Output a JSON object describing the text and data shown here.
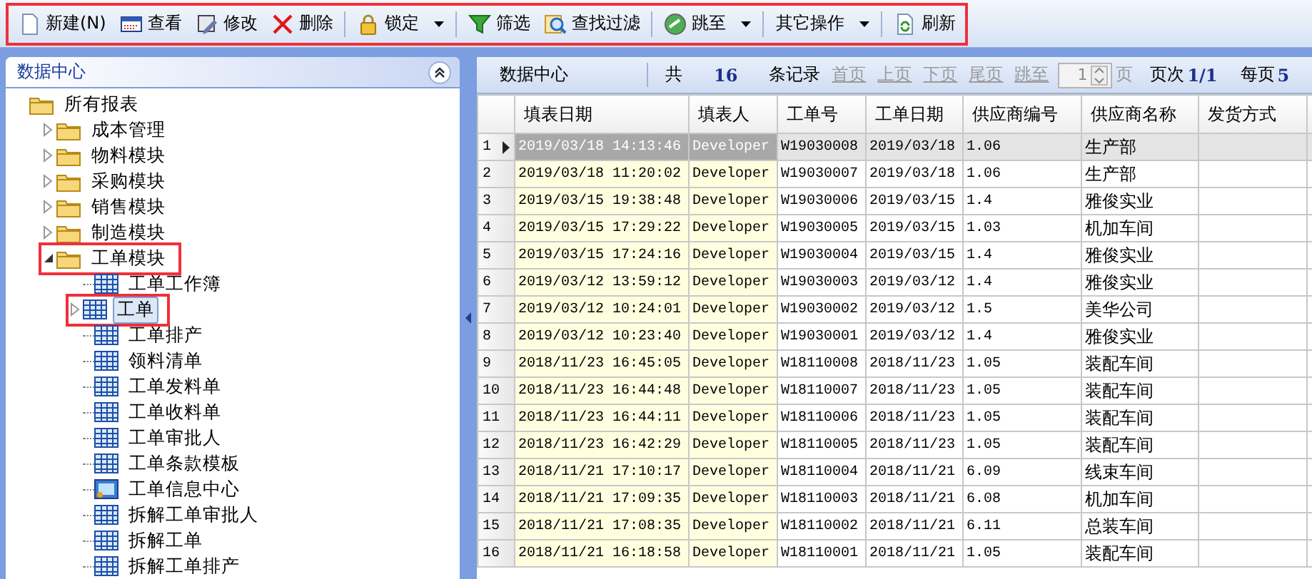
{
  "toolbar": {
    "highlighted": true,
    "items": [
      {
        "kind": "button",
        "label": "新建(N)"
      },
      {
        "kind": "button",
        "label": "查看"
      },
      {
        "kind": "button",
        "label": "修改"
      },
      {
        "kind": "button",
        "label": "删除"
      },
      {
        "kind": "separator"
      },
      {
        "kind": "dropdown",
        "label": "锁定"
      },
      {
        "kind": "separator"
      },
      {
        "kind": "button",
        "label": "筛选"
      },
      {
        "kind": "button",
        "label": "查找过滤"
      },
      {
        "kind": "separator"
      },
      {
        "kind": "dropdown",
        "label": "跳至"
      },
      {
        "kind": "separator"
      },
      {
        "kind": "dropdown",
        "label": "其它操作"
      },
      {
        "kind": "separator"
      },
      {
        "kind": "button",
        "label": "刷新"
      }
    ]
  },
  "sidebar": {
    "title": "数据中心",
    "tree": [
      {
        "label": "所有报表",
        "kind": "folder",
        "children": [
          {
            "label": "成本管理",
            "kind": "folder",
            "expanded": false
          },
          {
            "label": "物料模块",
            "kind": "folder",
            "expanded": false
          },
          {
            "label": "采购模块",
            "kind": "folder",
            "expanded": false
          },
          {
            "label": "销售模块",
            "kind": "folder",
            "expanded": false
          },
          {
            "label": "制造模块",
            "kind": "folder",
            "expanded": false
          },
          {
            "label": "工单模块",
            "kind": "folder",
            "expanded": true,
            "highlighted": true,
            "children": [
              {
                "label": "工单工作簿",
                "kind": "table",
                "selected": false
              },
              {
                "label": "工单",
                "kind": "table",
                "selected": true,
                "expanded": false,
                "highlighted": true
              },
              {
                "label": "工单排产",
                "kind": "table",
                "selected": false
              },
              {
                "label": "领料清单",
                "kind": "table",
                "selected": false
              },
              {
                "label": "工单发料单",
                "kind": "table",
                "selected": false
              },
              {
                "label": "工单收料单",
                "kind": "table",
                "selected": false
              },
              {
                "label": "工单审批人",
                "kind": "table",
                "selected": false
              },
              {
                "label": "工单条款模板",
                "kind": "table",
                "selected": false
              },
              {
                "label": "工单信息中心",
                "kind": "info",
                "selected": false
              },
              {
                "label": "拆解工单审批人",
                "kind": "table",
                "selected": false
              },
              {
                "label": "拆解工单",
                "kind": "table",
                "selected": false
              },
              {
                "label": "拆解工单排产",
                "kind": "table",
                "selected": false
              }
            ]
          }
        ]
      }
    ]
  },
  "grid": {
    "title": "数据中心",
    "pager": {
      "total_label": "共",
      "total": "16",
      "records_label": "条记录",
      "links": [
        {
          "label": "首页",
          "disabled": true
        },
        {
          "label": "上页",
          "disabled": true
        },
        {
          "label": "下页",
          "disabled": true
        },
        {
          "label": "尾页",
          "disabled": true
        },
        {
          "label": "跳至",
          "disabled": true
        }
      ],
      "page_value": "1",
      "page_unit": "页",
      "page_unit_disabled": true,
      "pages_label": "页次",
      "pages": "1/1",
      "per_page_label": "每页",
      "per_page": "5"
    },
    "columns": [
      {
        "label": "填表日期",
        "highlighted": true
      },
      {
        "label": "填表人",
        "highlighted": true
      },
      {
        "label": "工单号",
        "highlighted": false
      },
      {
        "label": "工单日期",
        "highlighted": false
      },
      {
        "label": "供应商编号",
        "highlighted": false
      },
      {
        "label": "供应商名称",
        "highlighted": false
      },
      {
        "label": "发货方式",
        "highlighted": false
      }
    ],
    "rows": [
      {
        "number": "1",
        "selected": true,
        "cells": [
          "2019/03/18 14:13:46",
          "Developer",
          "W19030008",
          "2019/03/18",
          "1.06",
          "生产部",
          ""
        ]
      },
      {
        "number": "2",
        "selected": false,
        "cells": [
          "2019/03/18 11:20:02",
          "Developer",
          "W19030007",
          "2019/03/18",
          "1.06",
          "生产部",
          ""
        ]
      },
      {
        "number": "3",
        "selected": false,
        "cells": [
          "2019/03/15 19:38:48",
          "Developer",
          "W19030006",
          "2019/03/15",
          "1.4",
          "雅俊实业",
          ""
        ]
      },
      {
        "number": "4",
        "selected": false,
        "cells": [
          "2019/03/15 17:29:22",
          "Developer",
          "W19030005",
          "2019/03/15",
          "1.03",
          "机加车间",
          ""
        ]
      },
      {
        "number": "5",
        "selected": false,
        "cells": [
          "2019/03/15 17:24:16",
          "Developer",
          "W19030004",
          "2019/03/15",
          "1.4",
          "雅俊实业",
          ""
        ]
      },
      {
        "number": "6",
        "selected": false,
        "cells": [
          "2019/03/12 13:59:12",
          "Developer",
          "W19030003",
          "2019/03/12",
          "1.4",
          "雅俊实业",
          ""
        ]
      },
      {
        "number": "7",
        "selected": false,
        "cells": [
          "2019/03/12 10:24:01",
          "Developer",
          "W19030002",
          "2019/03/12",
          "1.5",
          "美华公司",
          ""
        ]
      },
      {
        "number": "8",
        "selected": false,
        "cells": [
          "2019/03/12 10:23:40",
          "Developer",
          "W19030001",
          "2019/03/12",
          "1.4",
          "雅俊实业",
          ""
        ]
      },
      {
        "number": "9",
        "selected": false,
        "cells": [
          "2018/11/23 16:45:05",
          "Developer",
          "W18110008",
          "2018/11/23",
          "1.05",
          "装配车间",
          ""
        ]
      },
      {
        "number": "10",
        "selected": false,
        "cells": [
          "2018/11/23 16:44:48",
          "Developer",
          "W18110007",
          "2018/11/23",
          "1.05",
          "装配车间",
          ""
        ]
      },
      {
        "number": "11",
        "selected": false,
        "cells": [
          "2018/11/23 16:44:11",
          "Developer",
          "W18110006",
          "2018/11/23",
          "1.05",
          "装配车间",
          ""
        ]
      },
      {
        "number": "12",
        "selected": false,
        "cells": [
          "2018/11/23 16:42:29",
          "Developer",
          "W18110005",
          "2018/11/23",
          "1.05",
          "装配车间",
          ""
        ]
      },
      {
        "number": "13",
        "selected": false,
        "cells": [
          "2018/11/21 17:10:17",
          "Developer",
          "W18110004",
          "2018/11/21",
          "6.09",
          "线束车间",
          ""
        ]
      },
      {
        "number": "14",
        "selected": false,
        "cells": [
          "2018/11/21 17:09:35",
          "Developer",
          "W18110003",
          "2018/11/21",
          "6.08",
          "机加车间",
          ""
        ]
      },
      {
        "number": "15",
        "selected": false,
        "cells": [
          "2018/11/21 17:08:35",
          "Developer",
          "W18110002",
          "2018/11/21",
          "6.11",
          "总装车间",
          ""
        ]
      },
      {
        "number": "16",
        "selected": false,
        "cells": [
          "2018/11/21 16:18:58",
          "Developer",
          "W18110001",
          "2018/11/21",
          "1.05",
          "装配车间",
          ""
        ]
      }
    ]
  }
}
